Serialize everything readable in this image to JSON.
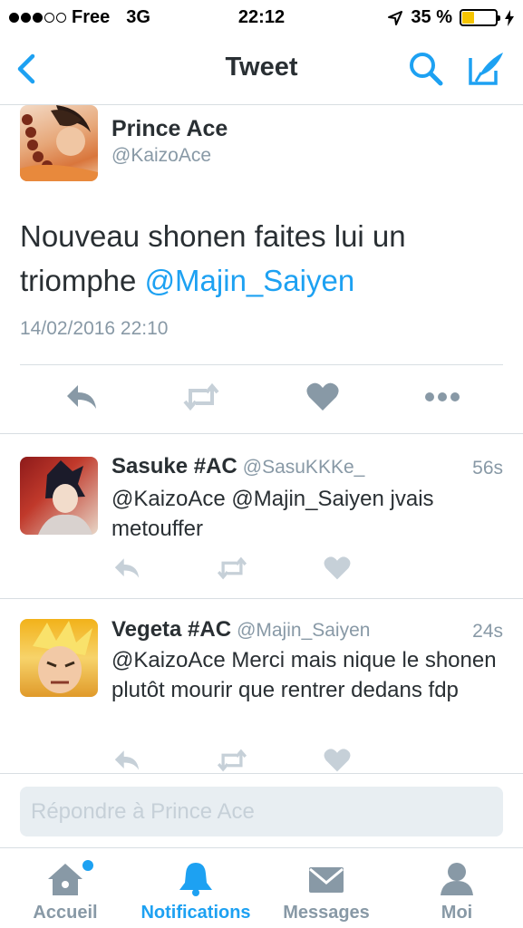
{
  "status_bar": {
    "carrier": "Free",
    "network": "3G",
    "time": "22:12",
    "battery_percent": "35 %",
    "signal_bars_filled": 3,
    "signal_bars_total": 5,
    "battery_level": 0.35
  },
  "nav": {
    "title": "Tweet",
    "back_icon": "chevron-left-icon",
    "search_icon": "search-icon",
    "compose_icon": "compose-icon"
  },
  "main_tweet": {
    "author_name": "Prince Ace",
    "author_handle": "@KaizoAce",
    "text_plain": "Nouveau shonen faites lui un triomphe ",
    "text_mention": "@Majin_Saiyen",
    "date": "14/02/2016 22:10",
    "actions": [
      "reply-icon",
      "retweet-icon",
      "like-icon",
      "more-icon"
    ]
  },
  "replies": [
    {
      "name": "Sasuke #AC",
      "handle": "@SasuKKKe_",
      "time": "56s",
      "text": "@KaizoAce @Majin_Saiyen jvais metouffer"
    },
    {
      "name": "Vegeta #AC",
      "handle": "@Majin_Saiyen",
      "time": "24s",
      "text": "@KaizoAce Merci mais nique le shonen plutôt mourir que rentrer dedans fdp"
    }
  ],
  "reply_bar": {
    "placeholder": "Répondre à Prince Ace"
  },
  "tabs": [
    {
      "label": "Accueil",
      "icon": "home-icon",
      "active": false,
      "has_dot": true
    },
    {
      "label": "Notifications",
      "icon": "bell-icon",
      "active": true,
      "has_dot": false
    },
    {
      "label": "Messages",
      "icon": "envelope-icon",
      "active": false,
      "has_dot": false
    },
    {
      "label": "Moi",
      "icon": "profile-icon",
      "active": false,
      "has_dot": false
    }
  ],
  "colors": {
    "accent": "#1da1f2",
    "text": "#292f33",
    "muted": "#8899a6",
    "icon_muted": "#c6d0d8"
  }
}
